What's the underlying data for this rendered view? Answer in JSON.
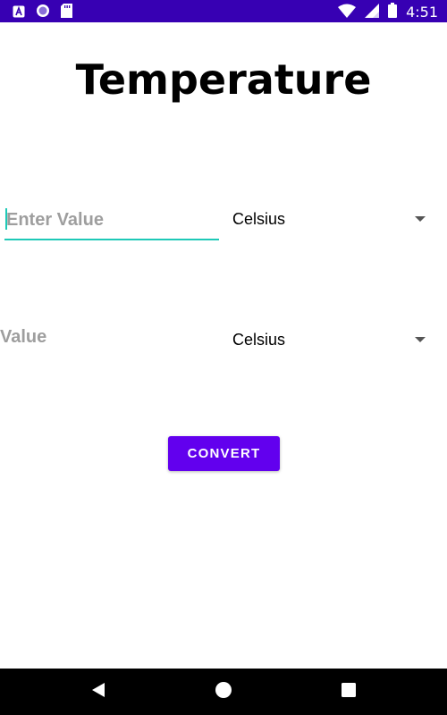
{
  "status_bar": {
    "time": "4:51",
    "left_icons": [
      "accessibility-a-icon",
      "circle-notification-icon",
      "sd-card-icon"
    ],
    "right_icons": [
      "wifi-icon",
      "signal-icon",
      "battery-icon"
    ],
    "color": "#3700b3"
  },
  "app": {
    "title": "Temperature"
  },
  "input": {
    "placeholder": "Enter Value",
    "value": "",
    "underline_color": "#1ec9b7"
  },
  "from_unit": {
    "selected": "Celsius"
  },
  "result": {
    "label": "Value"
  },
  "to_unit": {
    "selected": "Celsius"
  },
  "convert_button": {
    "label": "CONVERT",
    "color": "#6200ee"
  },
  "nav_bar": {
    "icons": [
      "back-icon",
      "home-icon",
      "recents-icon"
    ]
  }
}
